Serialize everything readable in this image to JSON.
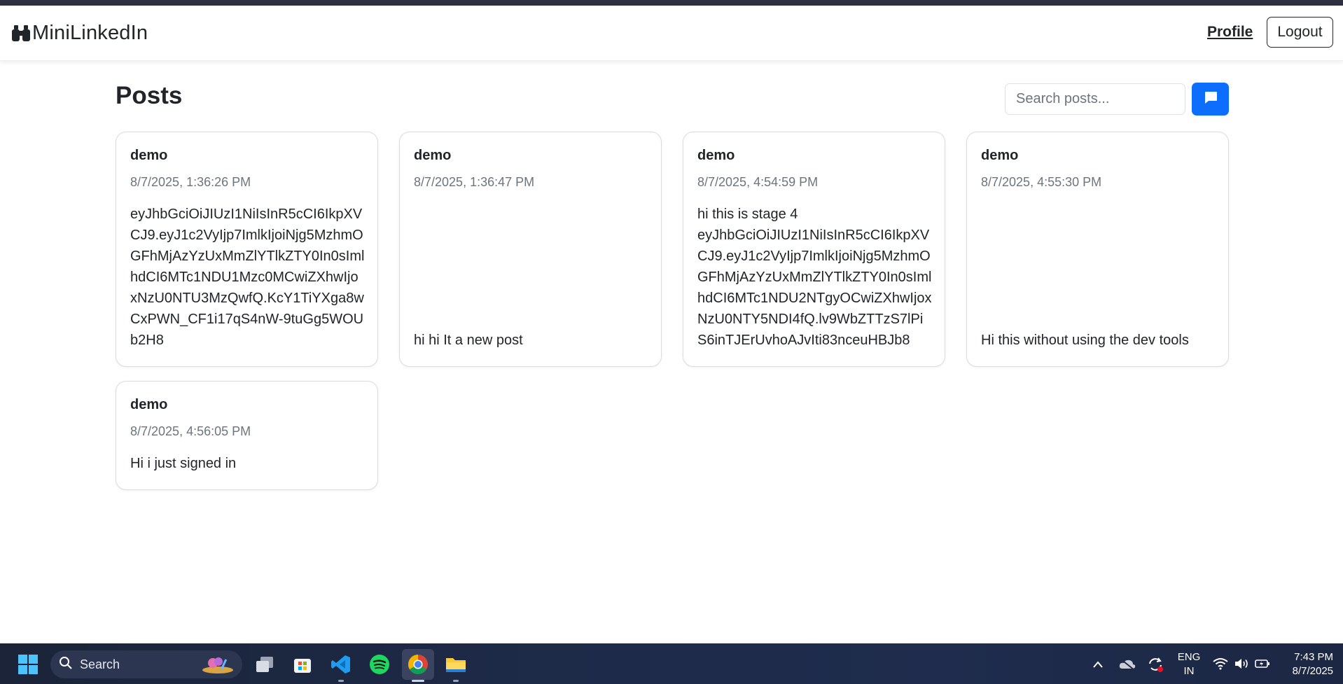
{
  "navbar": {
    "brand": "MiniLinkedIn",
    "profile_label": "Profile",
    "logout_label": "Logout"
  },
  "main": {
    "title": "Posts",
    "search_placeholder": "Search posts..."
  },
  "posts": [
    {
      "author": "demo",
      "date": "8/7/2025, 1:36:26 PM",
      "content": "eyJhbGciOiJIUzI1NiIsInR5cCI6IkpXVCJ9.eyJ1c2VyIjp7ImlkIjoiNjg5MzhmOGFhMjAzYzUxMmZlYTlkZTY0In0sImlhdCI6MTc1NDU1Mzc0MCwiZXhwIjoxNzU0NTU3MzQwfQ.KcY1TiYXga8wCxPWN_CF1i17qS4nW-9tuGg5WOUb2H8"
    },
    {
      "author": "demo",
      "date": "8/7/2025, 1:36:47 PM",
      "content": "hi hi It a new post"
    },
    {
      "author": "demo",
      "date": "8/7/2025, 4:54:59 PM",
      "content": "hi this is stage 4\neyJhbGciOiJIUzI1NiIsInR5cCI6IkpXVCJ9.eyJ1c2VyIjp7ImlkIjoiNjg5MzhmOGFhMjAzYzUxMmZlYTlkZTY0In0sImlhdCI6MTc1NDU2NTgyOCwiZXhwIjoxNzU0NTY5NDI4fQ.lv9WbZTTzS7lPiS6inTJErUvhoAJvIti83nceuHBJb8"
    },
    {
      "author": "demo",
      "date": "8/7/2025, 4:55:30 PM",
      "content": "Hi this without using the dev tools"
    },
    {
      "author": "demo",
      "date": "8/7/2025, 4:56:05 PM",
      "content": "Hi i just signed in"
    }
  ],
  "taskbar": {
    "search_label": "Search",
    "language_line1": "ENG",
    "language_line2": "IN",
    "time": "7:43 PM",
    "date": "8/7/2025",
    "icons": [
      "windows-start-icon",
      "search-icon",
      "task-view-icon",
      "microsoft-store-icon",
      "vscode-icon",
      "spotify-icon",
      "chrome-icon",
      "file-explorer-icon",
      "chevron-up-icon",
      "onedrive-icon",
      "sync-icon",
      "wifi-icon",
      "volume-icon",
      "battery-icon"
    ]
  },
  "colors": {
    "primary": "#0d6efd",
    "text": "#212529",
    "muted": "#6c757d",
    "border": "#dcdcdc"
  }
}
